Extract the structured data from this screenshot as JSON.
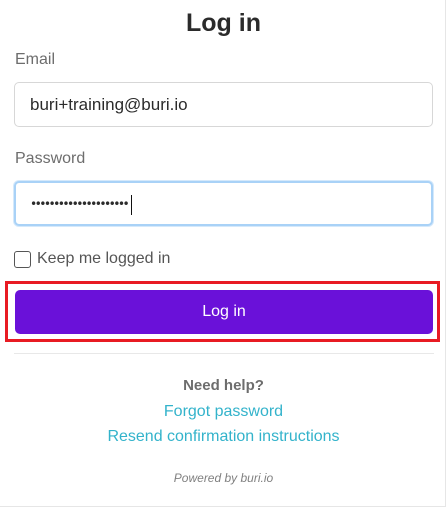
{
  "page": {
    "title": "Log in"
  },
  "form": {
    "email_label": "Email",
    "email_value": "buri+training@buri.io",
    "password_label": "Password",
    "password_masked": "•••••••••••••••••••••",
    "remember_label": "Keep me logged in",
    "remember_checked": false,
    "submit_label": "Log in"
  },
  "help": {
    "title": "Need help?",
    "forgot_label": "Forgot password",
    "resend_label": "Resend confirmation instructions"
  },
  "footer": {
    "powered_by": "Powered by buri.io"
  },
  "colors": {
    "primary_button": "#6a11d9",
    "link": "#33b3cb",
    "highlight": "#e81b23",
    "focus_ring": "#a9d2f7"
  }
}
